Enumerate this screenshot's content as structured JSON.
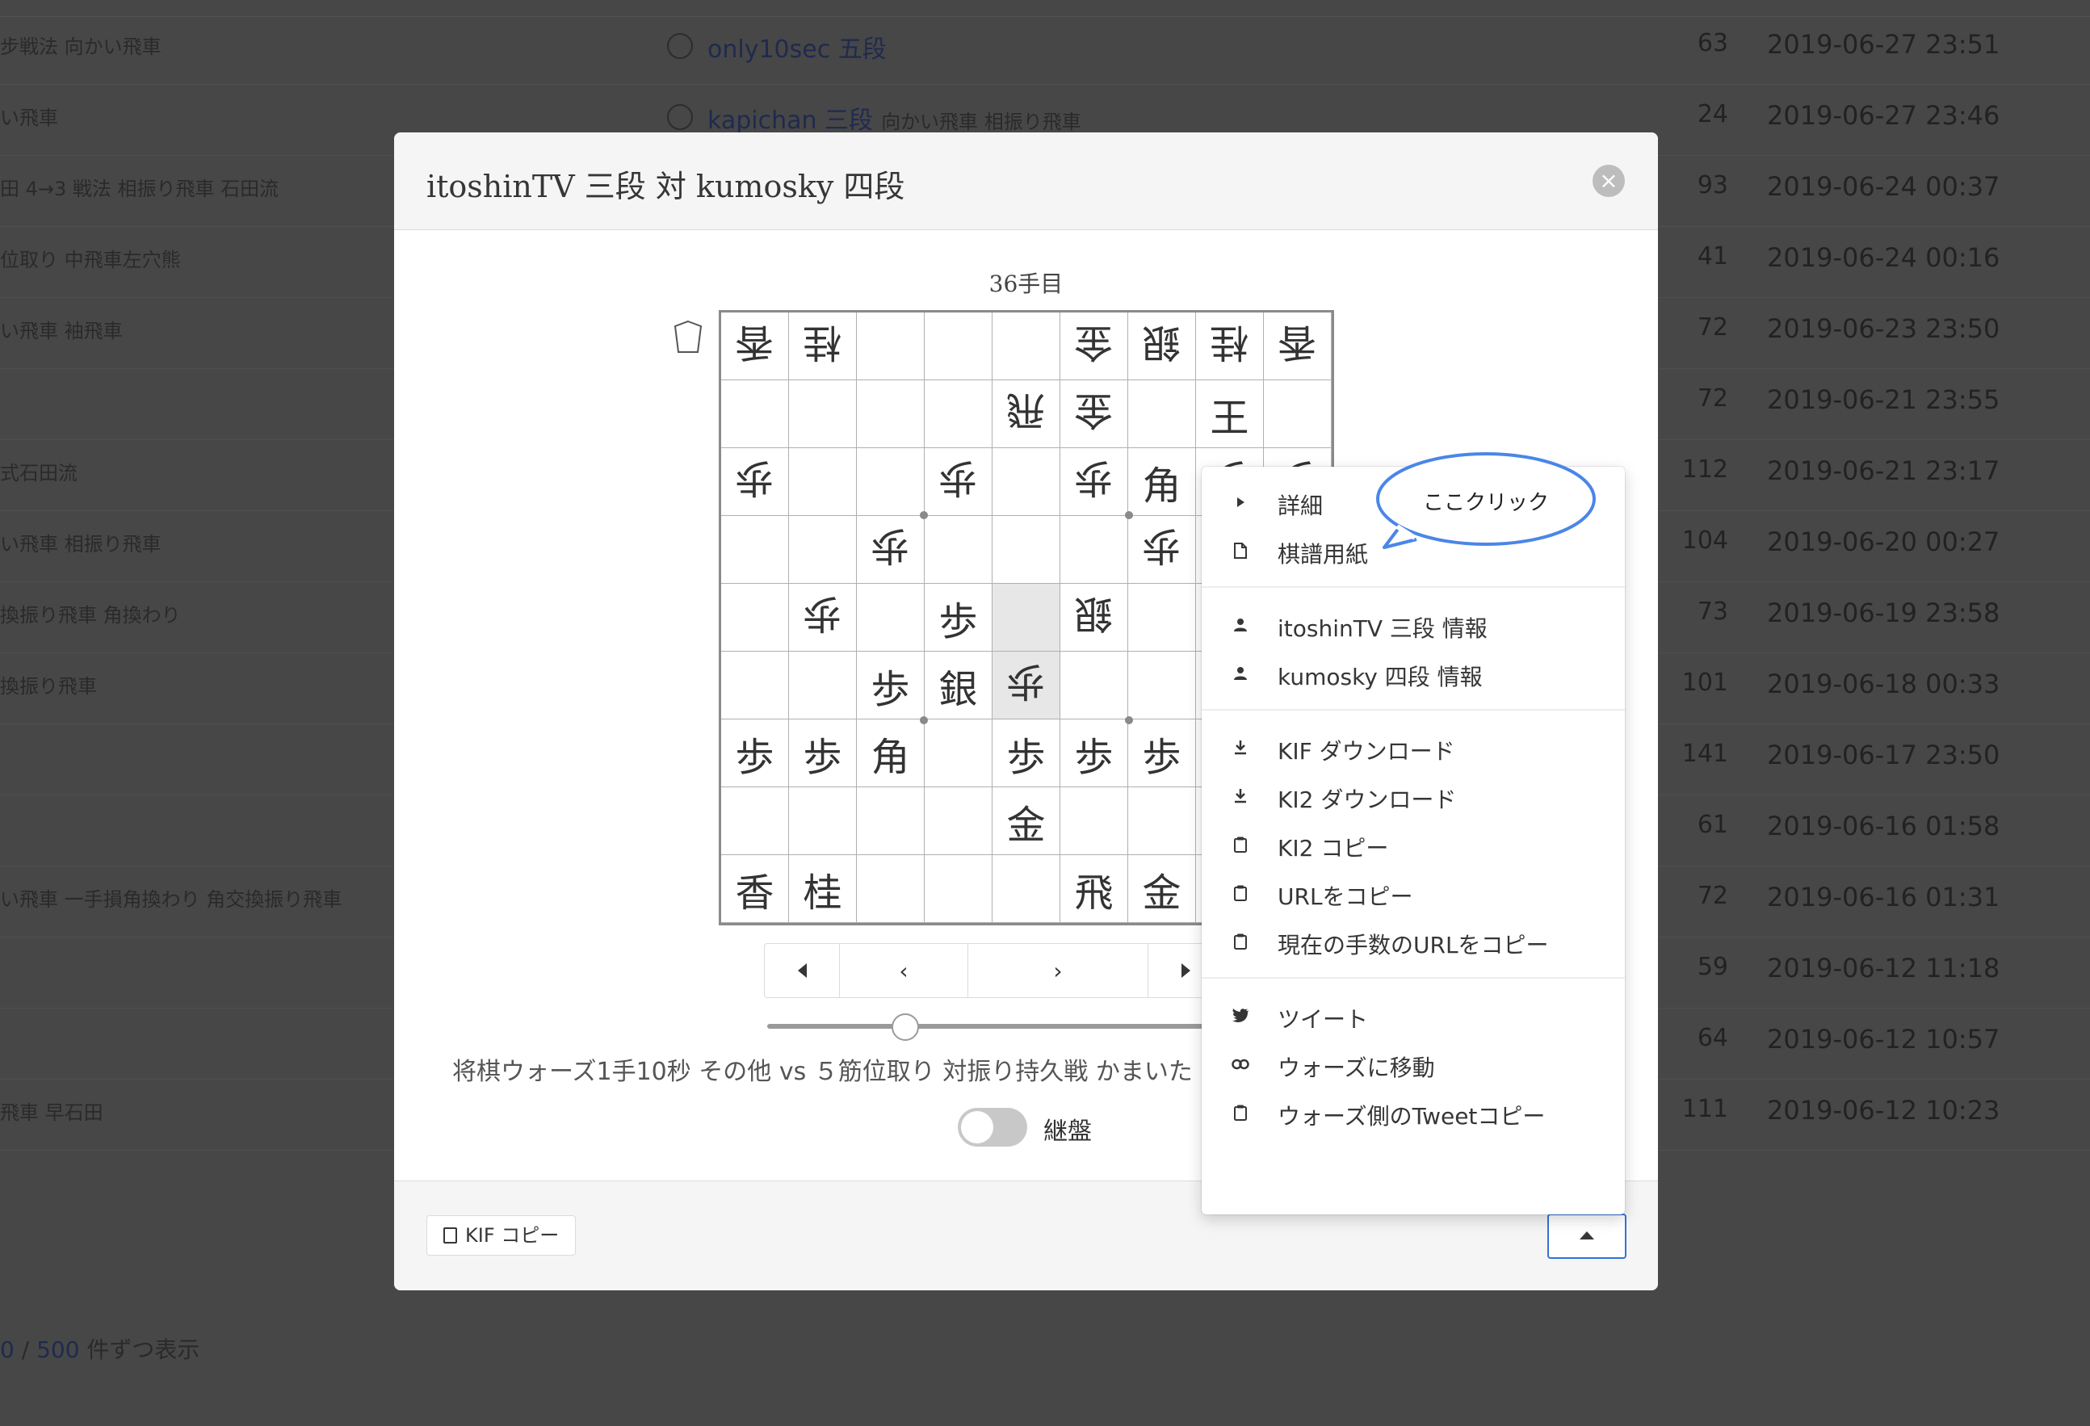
{
  "background": {
    "rows": [
      {
        "tags": "步戦法 向かい飛車",
        "player": "only10sec 五段",
        "player_sub": "",
        "moves": "63",
        "date": "2019-06-27 23:51"
      },
      {
        "tags": "い飛車",
        "player": "kapichan 三段",
        "player_sub": "向かい飛車 相振り飛車",
        "moves": "24",
        "date": "2019-06-27 23:46"
      },
      {
        "tags": "田 4→3 戦法 相振り飛車 石田流",
        "player": "",
        "player_sub": "",
        "moves": "93",
        "date": "2019-06-24 00:37"
      },
      {
        "tags": "位取り 中飛車左穴熊",
        "player": "",
        "player_sub": "",
        "moves": "41",
        "date": "2019-06-24 00:16"
      },
      {
        "tags": "い飛車 袖飛車",
        "player": "",
        "player_sub": "",
        "moves": "72",
        "date": "2019-06-23 23:50"
      },
      {
        "tags": "",
        "player": "",
        "player_sub": "",
        "moves": "72",
        "date": "2019-06-21 23:55"
      },
      {
        "tags": "式石田流",
        "player": "",
        "player_sub": "",
        "moves": "112",
        "date": "2019-06-21 23:17"
      },
      {
        "tags": "い飛車 相振り飛車",
        "player": "",
        "player_sub": "",
        "moves": "104",
        "date": "2019-06-20 00:27"
      },
      {
        "tags": "換振り飛車 角換わり",
        "player": "",
        "player_sub": "",
        "moves": "73",
        "date": "2019-06-19 23:58"
      },
      {
        "tags": "換振り飛車",
        "player": "",
        "player_sub": "",
        "moves": "101",
        "date": "2019-06-18 00:33"
      },
      {
        "tags": "",
        "player": "",
        "player_sub": "",
        "moves": "141",
        "date": "2019-06-17 23:50"
      },
      {
        "tags": "",
        "player": "",
        "player_sub": "",
        "moves": "61",
        "date": "2019-06-16 01:58"
      },
      {
        "tags": "い飛車 一手損角換わり 角交換振り飛車",
        "player": "",
        "player_sub": "",
        "moves": "72",
        "date": "2019-06-16 01:31"
      },
      {
        "tags": "",
        "player": "",
        "player_sub": "",
        "moves": "59",
        "date": "2019-06-12 11:18"
      },
      {
        "tags": "",
        "player": "",
        "player_sub": "",
        "moves": "64",
        "date": "2019-06-12 10:57"
      },
      {
        "tags": "飛車 早石田",
        "player": "",
        "player_sub": "",
        "moves": "111",
        "date": "2019-06-12 10:23"
      }
    ],
    "footer_num": "0",
    "footer_sep": " / ",
    "footer_link": "500",
    "footer_text": " 件ずつ表示"
  },
  "modal": {
    "title": "itoshinTV 三段 対 kumosky 四段",
    "close_icon": "×",
    "turn_label": "36手目",
    "hand_icon": "komadai-icon",
    "board": [
      [
        [
          "香",
          true
        ],
        [
          "桂",
          true
        ],
        [
          "",
          false
        ],
        [
          "",
          false
        ],
        [
          "",
          false
        ],
        [
          "金",
          true
        ],
        [
          "銀",
          true
        ],
        [
          "桂",
          true
        ],
        [
          "香",
          true
        ]
      ],
      [
        [
          "",
          false
        ],
        [
          "",
          false
        ],
        [
          "",
          false
        ],
        [
          "",
          false
        ],
        [
          "飛",
          true
        ],
        [
          "金",
          true
        ],
        [
          "",
          false
        ],
        [
          "王",
          false
        ],
        [
          "",
          false
        ]
      ],
      [
        [
          "歩",
          true
        ],
        [
          "",
          false
        ],
        [
          "",
          false
        ],
        [
          "歩",
          true
        ],
        [
          "",
          false
        ],
        [
          "歩",
          true
        ],
        [
          "角",
          false
        ],
        [
          "歩",
          true
        ],
        [
          "歩",
          true
        ]
      ],
      [
        [
          "",
          false
        ],
        [
          "",
          false
        ],
        [
          "歩",
          true
        ],
        [
          "",
          false
        ],
        [
          "",
          false
        ],
        [
          "",
          false
        ],
        [
          "歩",
          true
        ],
        [
          "",
          false
        ],
        [
          "",
          false
        ]
      ],
      [
        [
          "",
          false
        ],
        [
          "歩",
          true
        ],
        [
          "",
          false
        ],
        [
          "歩",
          false
        ],
        [
          "",
          false
        ],
        [
          "銀",
          true
        ],
        [
          "",
          false
        ],
        [
          "",
          false
        ],
        [
          "",
          false
        ]
      ],
      [
        [
          "",
          false
        ],
        [
          "",
          false
        ],
        [
          "歩",
          false
        ],
        [
          "銀",
          false
        ],
        [
          "歩",
          true
        ],
        [
          "",
          false
        ],
        [
          "",
          false
        ],
        [
          "",
          false
        ],
        [
          "",
          false
        ]
      ],
      [
        [
          "歩",
          false
        ],
        [
          "歩",
          false
        ],
        [
          "角",
          false
        ],
        [
          "",
          false
        ],
        [
          "歩",
          false
        ],
        [
          "歩",
          false
        ],
        [
          "歩",
          false
        ],
        [
          "",
          false
        ],
        [
          "",
          false
        ]
      ],
      [
        [
          "",
          false
        ],
        [
          "",
          false
        ],
        [
          "",
          false
        ],
        [
          "",
          false
        ],
        [
          "金",
          false
        ],
        [
          "",
          false
        ],
        [
          "",
          false
        ],
        [
          "",
          false
        ],
        [
          "",
          false
        ]
      ],
      [
        [
          "香",
          false
        ],
        [
          "桂",
          false
        ],
        [
          "",
          false
        ],
        [
          "",
          false
        ],
        [
          "",
          false
        ],
        [
          "飛",
          false
        ],
        [
          "金",
          false
        ],
        [
          "",
          false
        ],
        [
          "",
          false
        ]
      ]
    ],
    "highlight": [
      [
        4,
        4
      ],
      [
        5,
        4
      ]
    ],
    "nav": {
      "first": "◀",
      "prev": "‹",
      "next": "›",
      "last": "▶"
    },
    "slider_value": 36,
    "description": "将棋ウォーズ1手10秒 その他 vs ５筋位取り 対振り持久戦 かまいた",
    "flip_label": "継盤",
    "flip_on": false,
    "kif_copy_label": "KIF コピー",
    "menu_toggle_icon": "caret-up-icon"
  },
  "dropdown": {
    "sections": [
      [
        {
          "icon": "play-icon",
          "label": "詳細"
        },
        {
          "icon": "file-icon",
          "label": "棋譜用紙"
        }
      ],
      [
        {
          "icon": "user-icon",
          "label": "itoshinTV 三段 情報"
        },
        {
          "icon": "user-icon",
          "label": "kumosky 四段 情報"
        }
      ],
      [
        {
          "icon": "download-icon",
          "label": "KIF ダウンロード"
        },
        {
          "icon": "download-icon",
          "label": "KI2 ダウンロード"
        },
        {
          "icon": "clipboard-icon",
          "label": "KI2 コピー"
        },
        {
          "icon": "clipboard-icon",
          "label": "URLをコピー"
        },
        {
          "icon": "clipboard-icon",
          "label": "現在の手数のURLをコピー"
        }
      ],
      [
        {
          "icon": "twitter-icon",
          "label": "ツイート"
        },
        {
          "icon": "link-icon",
          "label": "ウォーズに移動"
        },
        {
          "icon": "clipboard-icon",
          "label": "ウォーズ側のTweetコピー"
        }
      ]
    ]
  },
  "callout": {
    "text": "ここクリック",
    "color": "#4a86e8"
  }
}
